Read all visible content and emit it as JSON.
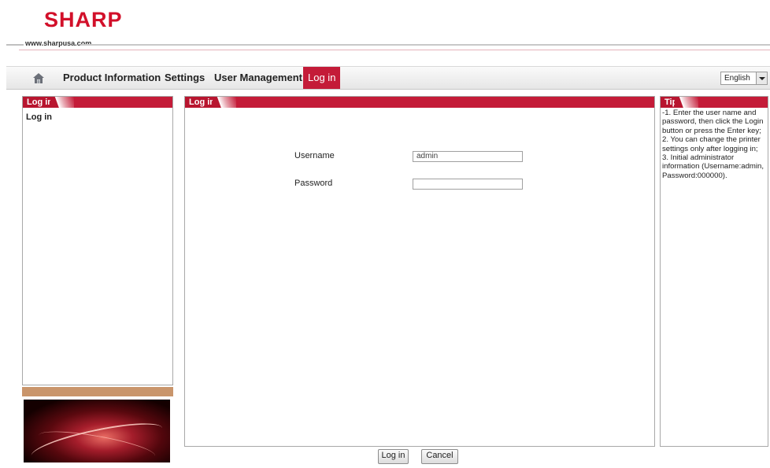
{
  "header": {
    "logo_text": "SHARP",
    "site_url": "www.sharpusa.com",
    "brand_color": "#d2102a"
  },
  "nav": {
    "home_icon": "home-icon",
    "items": [
      {
        "label": "Product Information",
        "active": false
      },
      {
        "label": "Settings",
        "active": false
      },
      {
        "label": "User Management",
        "active": false
      },
      {
        "label": "Log in",
        "active": true
      }
    ],
    "language": "English",
    "active_color": "#c41b38"
  },
  "left_panel": {
    "title": "Log in",
    "items": [
      "Log in"
    ]
  },
  "main_panel": {
    "title": "Log in",
    "username_label": "Username",
    "username_value": "admin",
    "password_label": "Password",
    "password_value": ""
  },
  "tip_panel": {
    "title": "Tip",
    "text": "-1. Enter the user name and password, then click the Login button or press the Enter key; 2. You can change the printer settings only after logging in; 3. Initial administrator information (Username:admin, Password:000000)."
  },
  "buttons": {
    "login_label": "Log in",
    "cancel_label": "Cancel"
  }
}
